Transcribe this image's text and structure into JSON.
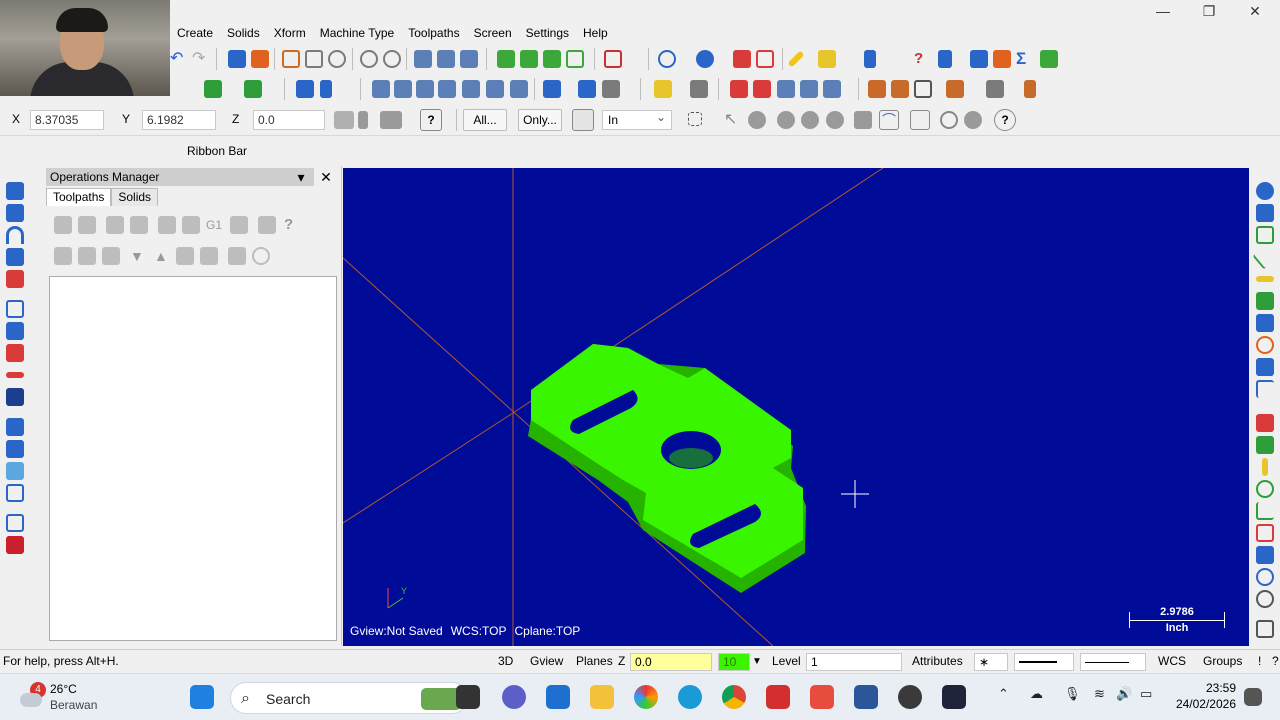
{
  "window": {
    "minimize": "—",
    "maximize": "❐",
    "close": "✕"
  },
  "menu": [
    "Create",
    "Solids",
    "Xform",
    "Machine Type",
    "Toolpaths",
    "Screen",
    "Settings",
    "Help"
  ],
  "coords": {
    "x_label": "X",
    "x_value": "8.37035",
    "y_label": "Y",
    "y_value": "6.1982",
    "z_label": "Z",
    "z_value": "0.0"
  },
  "selection": {
    "all_label": "All...",
    "only_label": "Only...",
    "mode_value": "In"
  },
  "ribbon_bar_label": "Ribbon Bar",
  "ops_manager": {
    "title": "Operations Manager",
    "tabs": [
      {
        "label": "Toolpaths",
        "active": true
      },
      {
        "label": "Solids",
        "active": false
      }
    ],
    "close": "✕",
    "dropdown": "▾"
  },
  "viewport": {
    "background": "#000b98",
    "part_color": "#39f500",
    "gview": "Gview:Not Saved",
    "wcs": "WCS:TOP",
    "cplane": "Cplane:TOP",
    "scale_value": "2.9786",
    "scale_unit": "Inch",
    "triad_y": "Y"
  },
  "statusbar": {
    "help": "For help, press Alt+H.",
    "view3d": "3D",
    "gview": "Gview",
    "planes": "Planes",
    "z_label": "Z",
    "z_value": "0.0",
    "color_value": "10",
    "level_label": "Level",
    "level_value": "1",
    "attributes": "Attributes",
    "point_style": "∗",
    "wcs": "WCS",
    "groups": "Groups",
    "bang": "!",
    "question": "?"
  },
  "taskbar": {
    "temperature": "26°C",
    "condition": "Berawan",
    "weather_badge": "4",
    "search_label": "Search",
    "time": "23:59",
    "date": "24/02/2026"
  }
}
